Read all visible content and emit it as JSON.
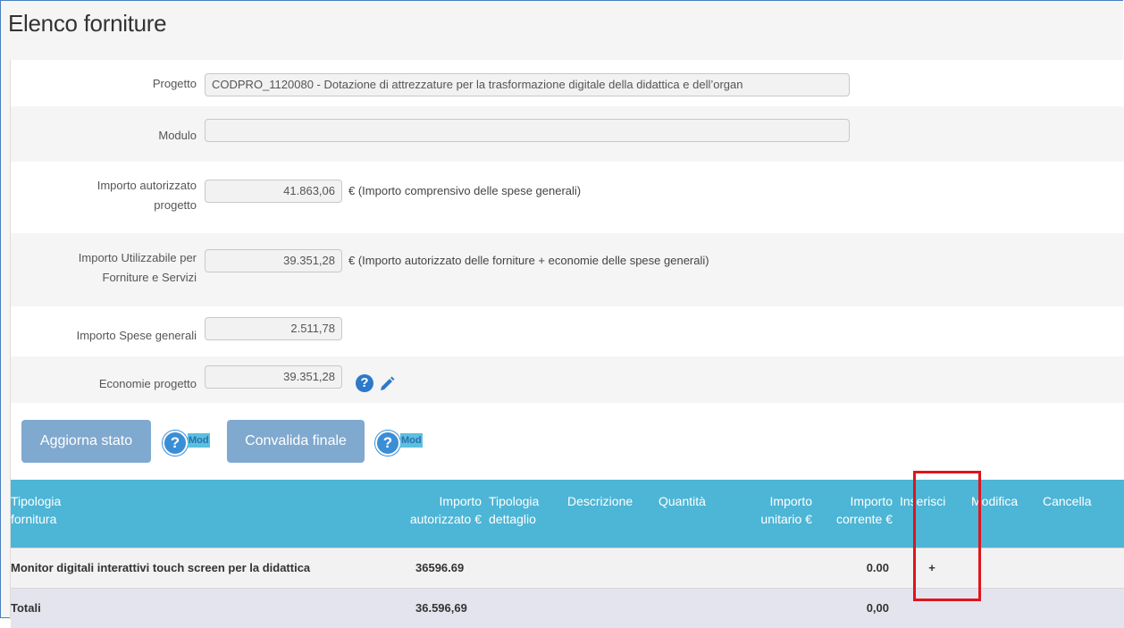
{
  "page": {
    "title": "Elenco forniture"
  },
  "form": {
    "progetto": {
      "label": "Progetto",
      "value": "CODPRO_1120080 - Dotazione di attrezzature per la trasformazione digitale della didattica e dell’organ"
    },
    "modulo": {
      "label": "Modulo",
      "value": ""
    },
    "importo_autorizzato": {
      "label_line1": "Importo autorizzato",
      "label_line2": "progetto",
      "value": "41.863,06",
      "note": "€ (Importo comprensivo delle spese generali)"
    },
    "importo_utilizzabile": {
      "label_line1": "Importo Utilizzabile per",
      "label_line2": "Forniture e Servizi",
      "value": "39.351,28",
      "note": "€ (Importo autorizzato delle forniture + economie delle spese generali)"
    },
    "spese_generali": {
      "label": "Importo Spese generali",
      "value": "2.511,78"
    },
    "economie": {
      "label": "Economie progetto",
      "value": "39.351,28",
      "help_icon": "question-circle-icon",
      "edit_icon": "pencil-icon"
    }
  },
  "actions": {
    "aggiorna": {
      "label": "Aggiorna stato",
      "help_icon": "question-circle-icon",
      "mod_label": "Mod"
    },
    "convalida": {
      "label": "Convalida finale",
      "help_icon": "question-circle-icon",
      "mod_label": "Mod"
    }
  },
  "table": {
    "headers": [
      {
        "l1": "Tipologia",
        "l2": "fornitura"
      },
      {
        "l1": "Importo",
        "l2": "autorizzato €"
      },
      {
        "l1": "Tipologia",
        "l2": "dettaglio"
      },
      {
        "l1": "Descrizione",
        "l2": ""
      },
      {
        "l1": "Quantità",
        "l2": ""
      },
      {
        "l1": "Importo",
        "l2": "unitario €"
      },
      {
        "l1": "Importo",
        "l2": "corrente €"
      },
      {
        "l1": "Inserisci",
        "l2": ""
      },
      {
        "l1": "Modifica",
        "l2": ""
      },
      {
        "l1": "Cancella",
        "l2": ""
      }
    ],
    "rows": [
      {
        "tipologia": "Monitor digitali interattivi touch screen per la didattica",
        "importo_autorizzato": "36596.69",
        "importo_corrente": "0.00",
        "inserisci_icon": "plus-icon",
        "inserisci_glyph": "+"
      }
    ],
    "totals": {
      "label": "Totali",
      "importo_autorizzato": "36.596,69",
      "importo_corrente": "0,00"
    }
  },
  "colors": {
    "header_bg": "#4db5d5",
    "button_bg": "#7fa9cf",
    "highlight": "#e0141c"
  }
}
